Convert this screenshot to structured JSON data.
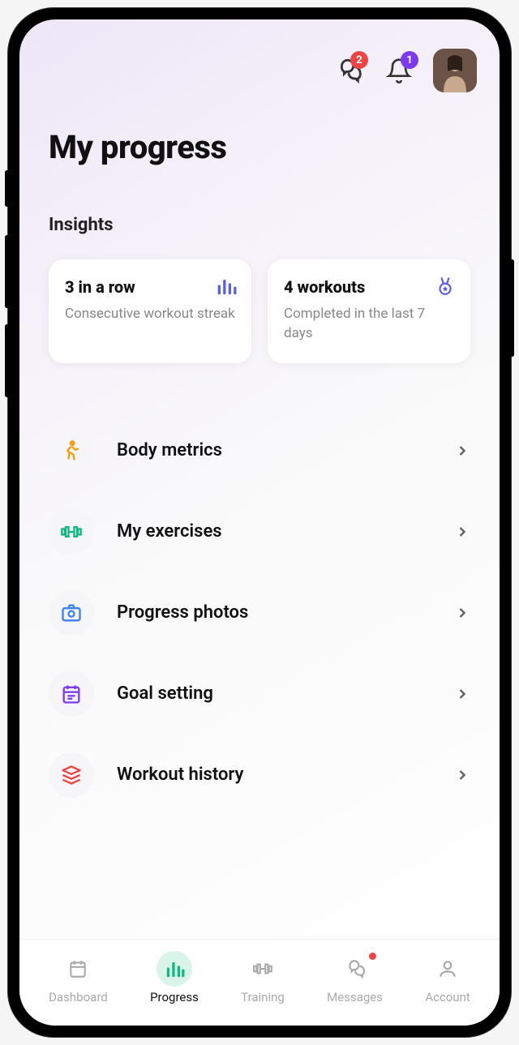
{
  "header": {
    "chat_badge": "2",
    "bell_badge": "1"
  },
  "page_title": "My progress",
  "insights": {
    "heading": "Insights",
    "cards": [
      {
        "title": "3 in a row",
        "subtitle": "Consecutive workout streak"
      },
      {
        "title": "4 workouts",
        "subtitle": "Completed in the last 7 days"
      }
    ]
  },
  "menu": [
    {
      "label": "Body metrics"
    },
    {
      "label": "My exercises"
    },
    {
      "label": "Progress photos"
    },
    {
      "label": "Goal setting"
    },
    {
      "label": "Workout history"
    }
  ],
  "tabs": [
    {
      "label": "Dashboard"
    },
    {
      "label": "Progress"
    },
    {
      "label": "Training"
    },
    {
      "label": "Messages"
    },
    {
      "label": "Account"
    }
  ]
}
